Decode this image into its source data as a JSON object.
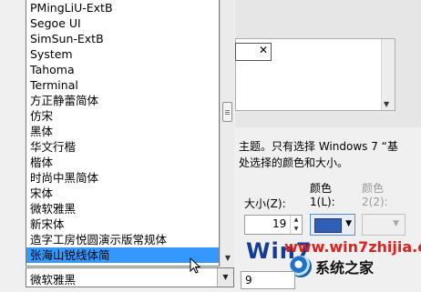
{
  "font_list": {
    "items": [
      "PMingLiU-ExtB",
      "Segoe UI",
      "SimSun-ExtB",
      "System",
      "Tahoma",
      "Terminal",
      "方正静蕾简体",
      "仿宋",
      "黑体",
      "华文行楷",
      "楷体",
      "时尚中黑简体",
      "宋体",
      "微软雅黑",
      "新宋体",
      "造字工房悦圆演示版常规体",
      "张海山锐线体简"
    ],
    "selected_index": 16
  },
  "font_combo": {
    "value": "微软雅黑"
  },
  "description": {
    "line1": "主题。只有选择 Windows 7 “基",
    "line2": "处选择的颜色和大小。"
  },
  "labels": {
    "color1_top": "颜色",
    "color2_top": "颜色",
    "size": "大小(Z):",
    "color1": "1(L):",
    "color2": "2(2):"
  },
  "size_spin": {
    "value": "19"
  },
  "size_input2": {
    "value": "9"
  },
  "watermark": {
    "logo": "Win7",
    "url": "www.win7zhijia.cn",
    "brand": "系统之家"
  },
  "icons": {
    "close": "close-icon",
    "dropdown": "chevron-down-icon",
    "cursor": "mouse-pointer-icon"
  },
  "colors": {
    "selection": "#3399ff",
    "color1_swatch": "#2f5eb4"
  }
}
